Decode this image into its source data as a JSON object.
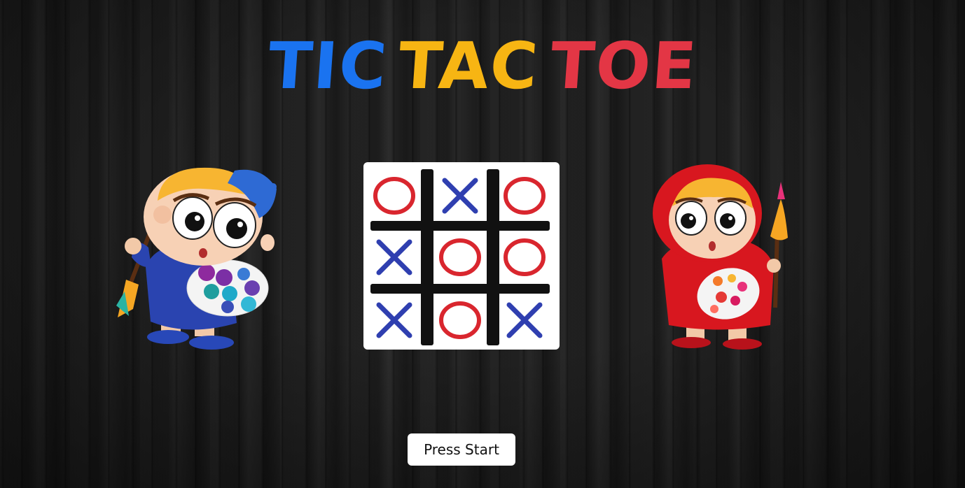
{
  "title": {
    "word1": "TIC",
    "word2": "TAC",
    "word3": "TOE",
    "colors": {
      "word1": "#1a73f0",
      "word2": "#f7b513",
      "word3": "#e33645"
    }
  },
  "board": {
    "cells": [
      "O",
      "X",
      "O",
      "X",
      "O",
      "O",
      "X",
      "O",
      "X"
    ],
    "colors": {
      "X": "#2f3fb0",
      "O": "#d9262e",
      "grid": "#111111"
    }
  },
  "characters": {
    "left": "boy-painter-icon",
    "right": "girl-painter-icon"
  },
  "start_button": {
    "label": "Press Start"
  }
}
